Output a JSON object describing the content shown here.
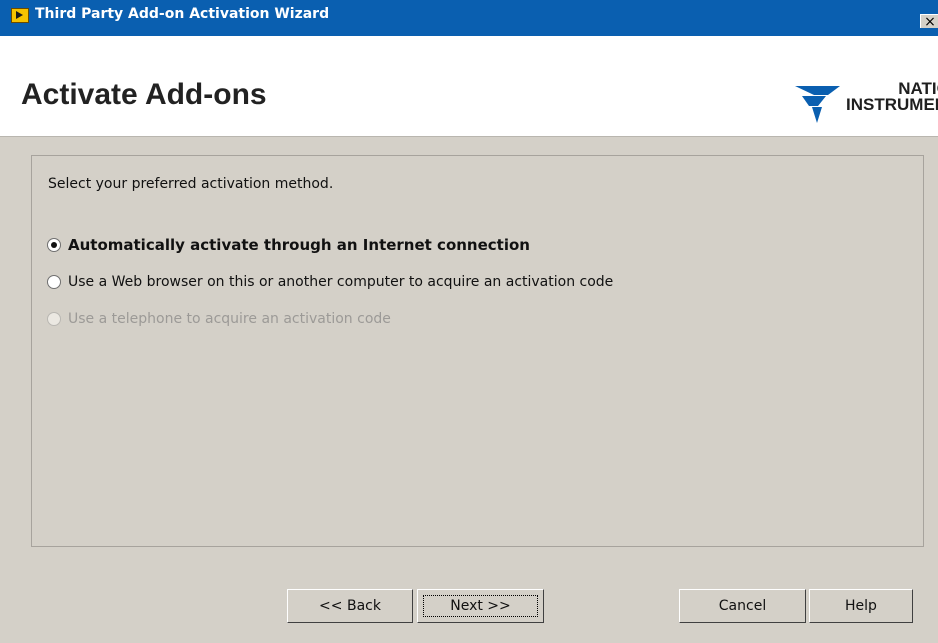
{
  "window": {
    "title": "Third Party Add-on Activation Wizard",
    "close_label": "×"
  },
  "header": {
    "title": "Activate Add-ons",
    "logo": {
      "line1": "NATIONAL",
      "line2": "INSTRUMENTS™"
    }
  },
  "panel": {
    "instruction": "Select your preferred activation method.",
    "options": [
      {
        "label": "Automatically activate through an Internet connection",
        "selected": true,
        "enabled": true
      },
      {
        "label": "Use a Web browser on this or another computer to acquire an activation code",
        "selected": false,
        "enabled": true
      },
      {
        "label": "Use a telephone to acquire an activation code",
        "selected": false,
        "enabled": false
      }
    ]
  },
  "buttons": {
    "back": "<< Back",
    "next": "Next >>",
    "cancel": "Cancel",
    "help": "Help"
  },
  "colors": {
    "titlebar": "#0a5fb0",
    "face": "#d4d0c8",
    "header_bg": "#ffffff",
    "logo_blue": "#0a5fb0"
  }
}
